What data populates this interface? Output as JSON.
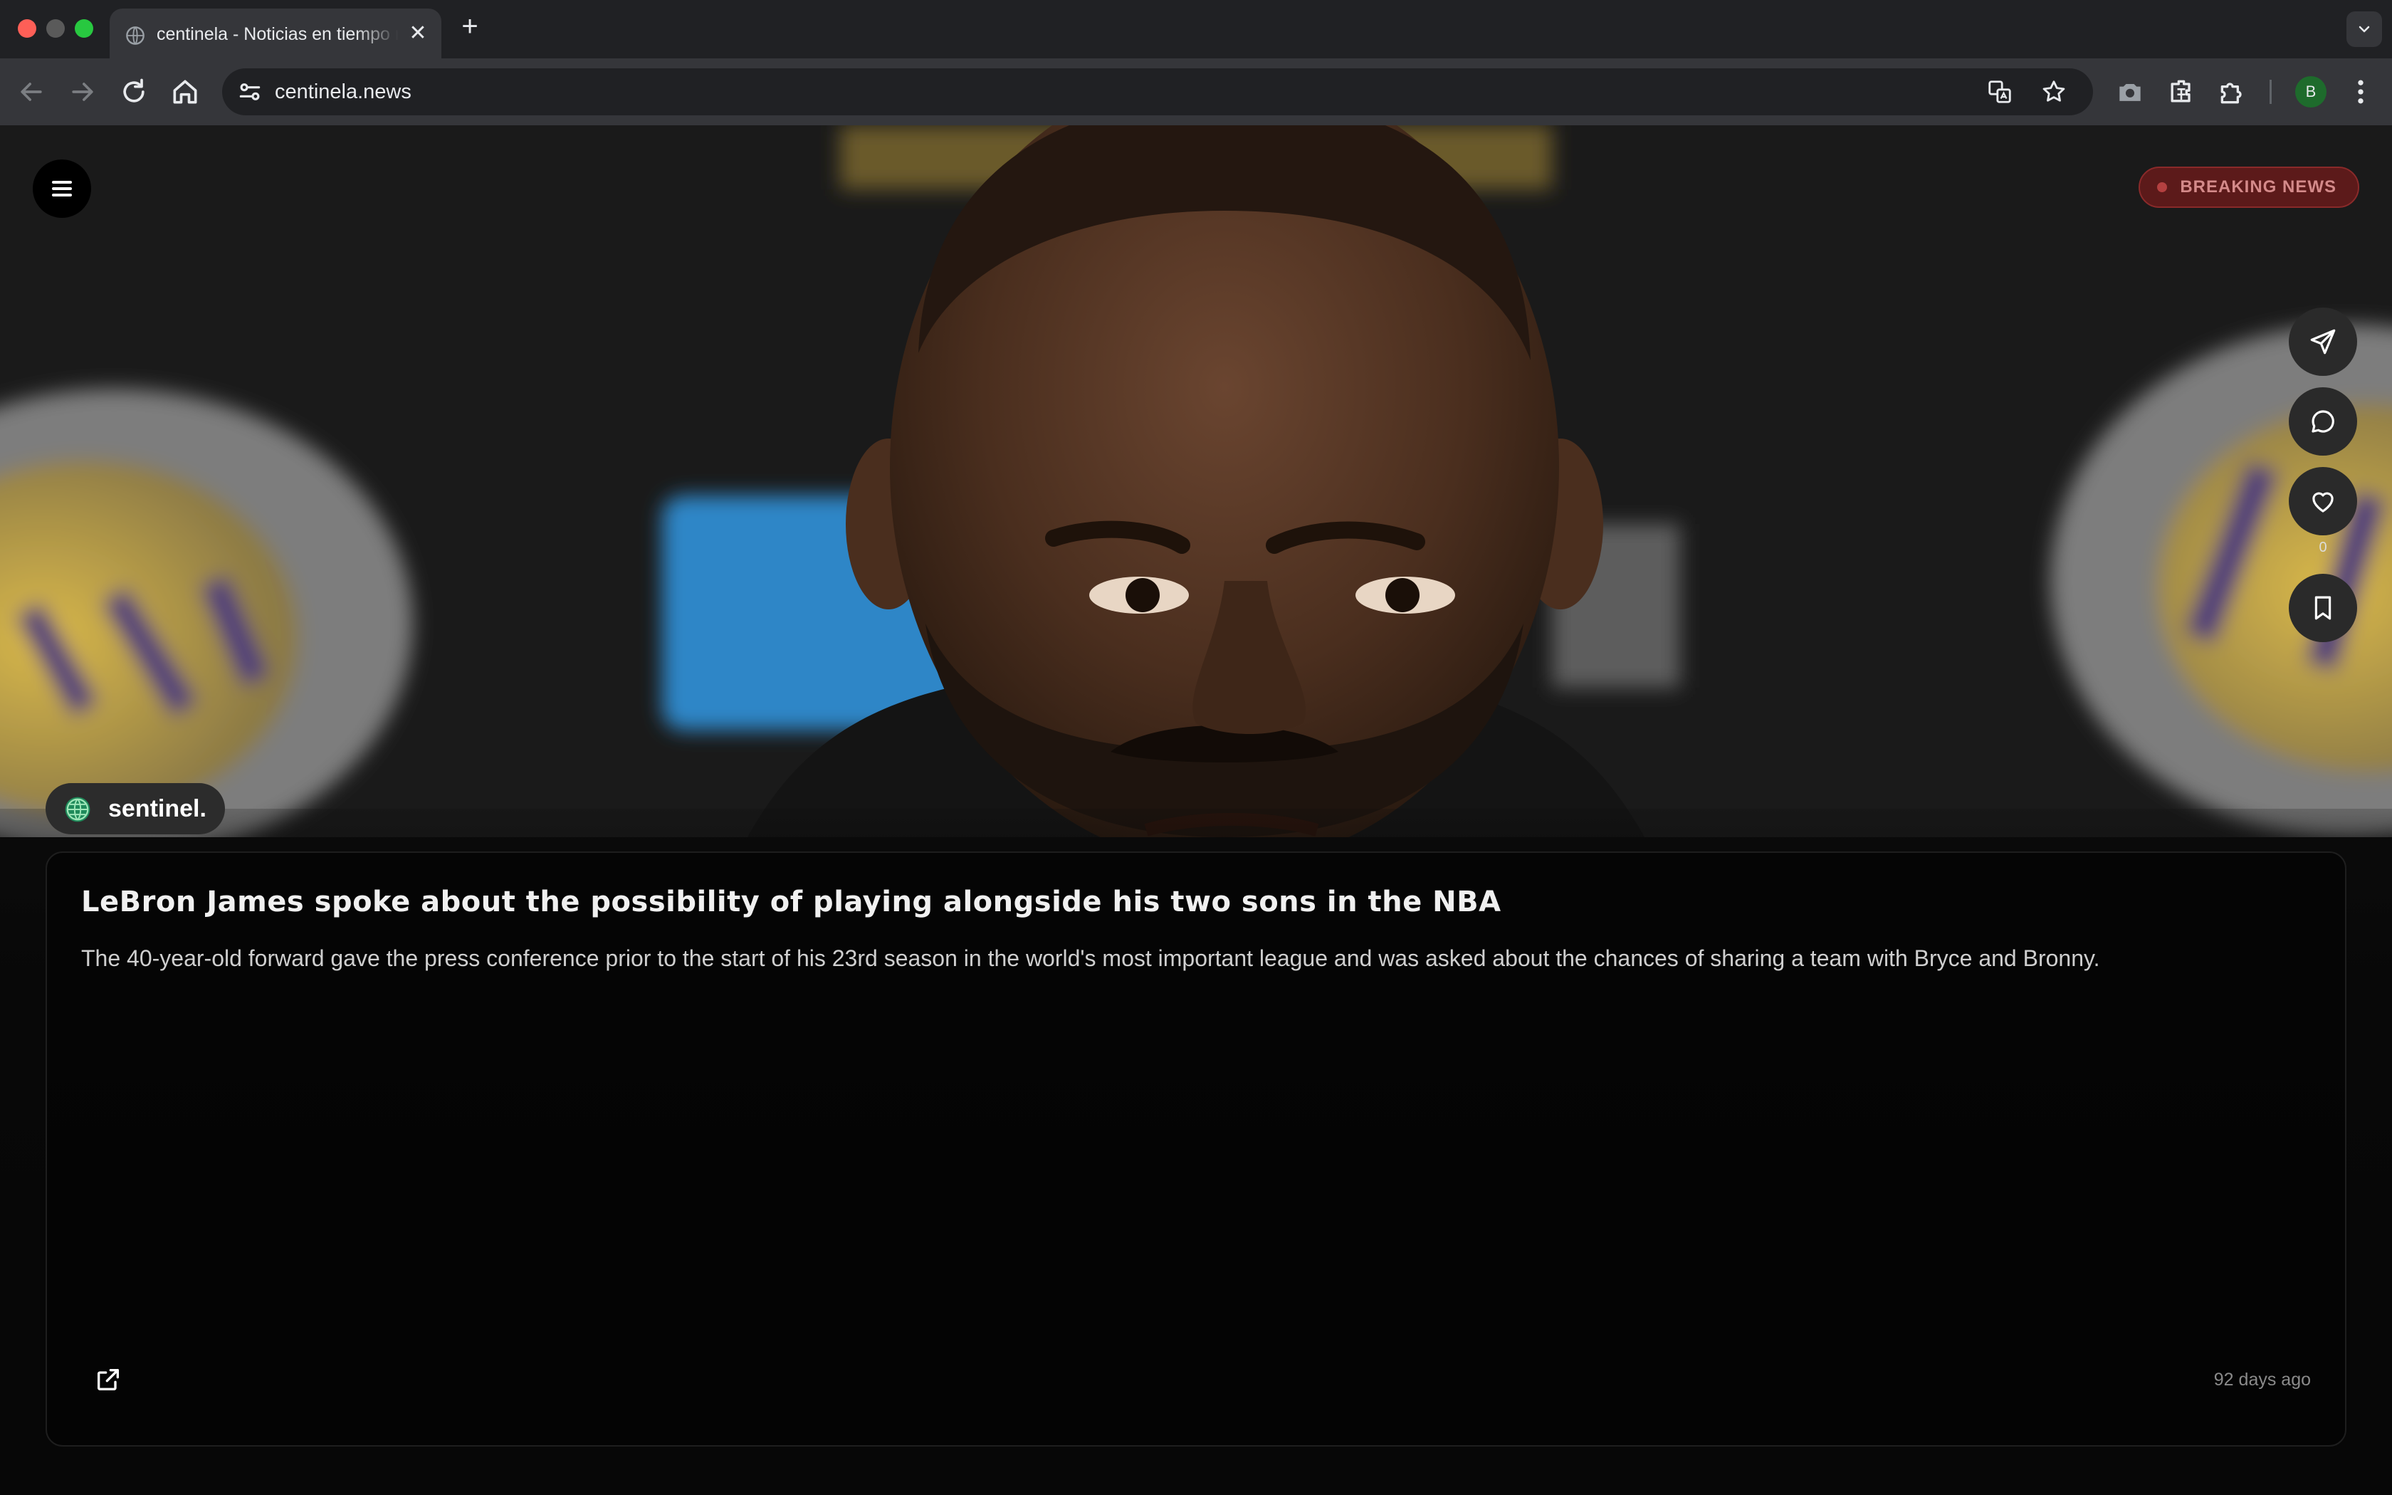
{
  "browser": {
    "tab_title": "centinela - Noticias en tiempo real",
    "tab_close": "✕",
    "new_tab": "+",
    "url": "centinela.news",
    "profile_initial": "B"
  },
  "page": {
    "breaking_label": "BREAKING NEWS",
    "source_name": "sentinel.",
    "like_count": "0",
    "headline": "LeBron James spoke about the possibility of playing alongside his two sons in the NBA",
    "summary": "The 40-year-old forward gave the press conference prior to the start of his 23rd season in the world's most important league and was asked about the chances of sharing a team with Bryce and Bronny.",
    "timestamp": "92 days ago"
  },
  "colors": {
    "breaking_bg": "#5c1a1a",
    "breaking_text": "#d48a8a",
    "profile_bg": "#1e6b2c"
  }
}
